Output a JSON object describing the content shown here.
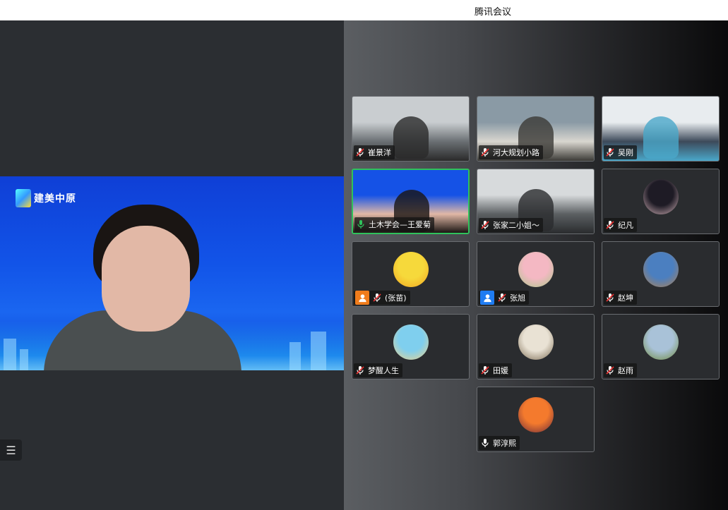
{
  "window": {
    "title": "腾讯会议"
  },
  "speaker": {
    "logo_text": "建美中原"
  },
  "participants": [
    {
      "name": "崔景洋",
      "mic": "muted",
      "kind": "video",
      "colors": [
        "#c9cdd0",
        "#6a6f73",
        "#2a2a2a"
      ]
    },
    {
      "name": "河大规划小路",
      "mic": "muted",
      "kind": "video",
      "colors": [
        "#8a9aa5",
        "#d9d6cf",
        "#3b3a36"
      ]
    },
    {
      "name": "吴刚",
      "mic": "muted",
      "kind": "video",
      "colors": [
        "#e8ecef",
        "#3d4a5a",
        "#4aa7c9"
      ]
    },
    {
      "name": "土木学会—王爱菊",
      "mic": "speaking",
      "kind": "video",
      "active": true,
      "colors": [
        "#1552e6",
        "#e1b8a6",
        "#1a1513"
      ]
    },
    {
      "name": "张家二小姐～",
      "mic": "muted",
      "kind": "video",
      "colors": [
        "#d7dadc",
        "#5b5f62",
        "#2a2c2e"
      ]
    },
    {
      "name": "纪凡",
      "mic": "muted",
      "kind": "avatar",
      "colors": [
        "#1e1b25",
        "#d2b2b8"
      ]
    },
    {
      "name": "(张苗)",
      "mic": "muted",
      "kind": "avatar",
      "badge": "orange",
      "colors": [
        "#f6d93b",
        "#f2a521"
      ]
    },
    {
      "name": "张旭",
      "mic": "muted",
      "kind": "avatar",
      "badge": "blue",
      "colors": [
        "#f4b8c3",
        "#a9c88a"
      ]
    },
    {
      "name": "赵坤",
      "mic": "muted",
      "kind": "avatar",
      "colors": [
        "#4b7fc0",
        "#b08050"
      ]
    },
    {
      "name": "梦醒人生",
      "mic": "muted",
      "kind": "avatar",
      "colors": [
        "#7fcfee",
        "#f0d38a"
      ]
    },
    {
      "name": "田媛",
      "mic": "muted",
      "kind": "avatar",
      "colors": [
        "#e9e2d4",
        "#7a6a52"
      ]
    },
    {
      "name": "赵雨",
      "mic": "muted",
      "kind": "avatar",
      "colors": [
        "#a9c2d8",
        "#6f8a3c"
      ]
    },
    {
      "name": "郭淳熙",
      "mic": "on",
      "kind": "avatar",
      "colors": [
        "#f47a2d",
        "#6a2a3a"
      ]
    }
  ],
  "side_toggle_icon": "list-icon"
}
